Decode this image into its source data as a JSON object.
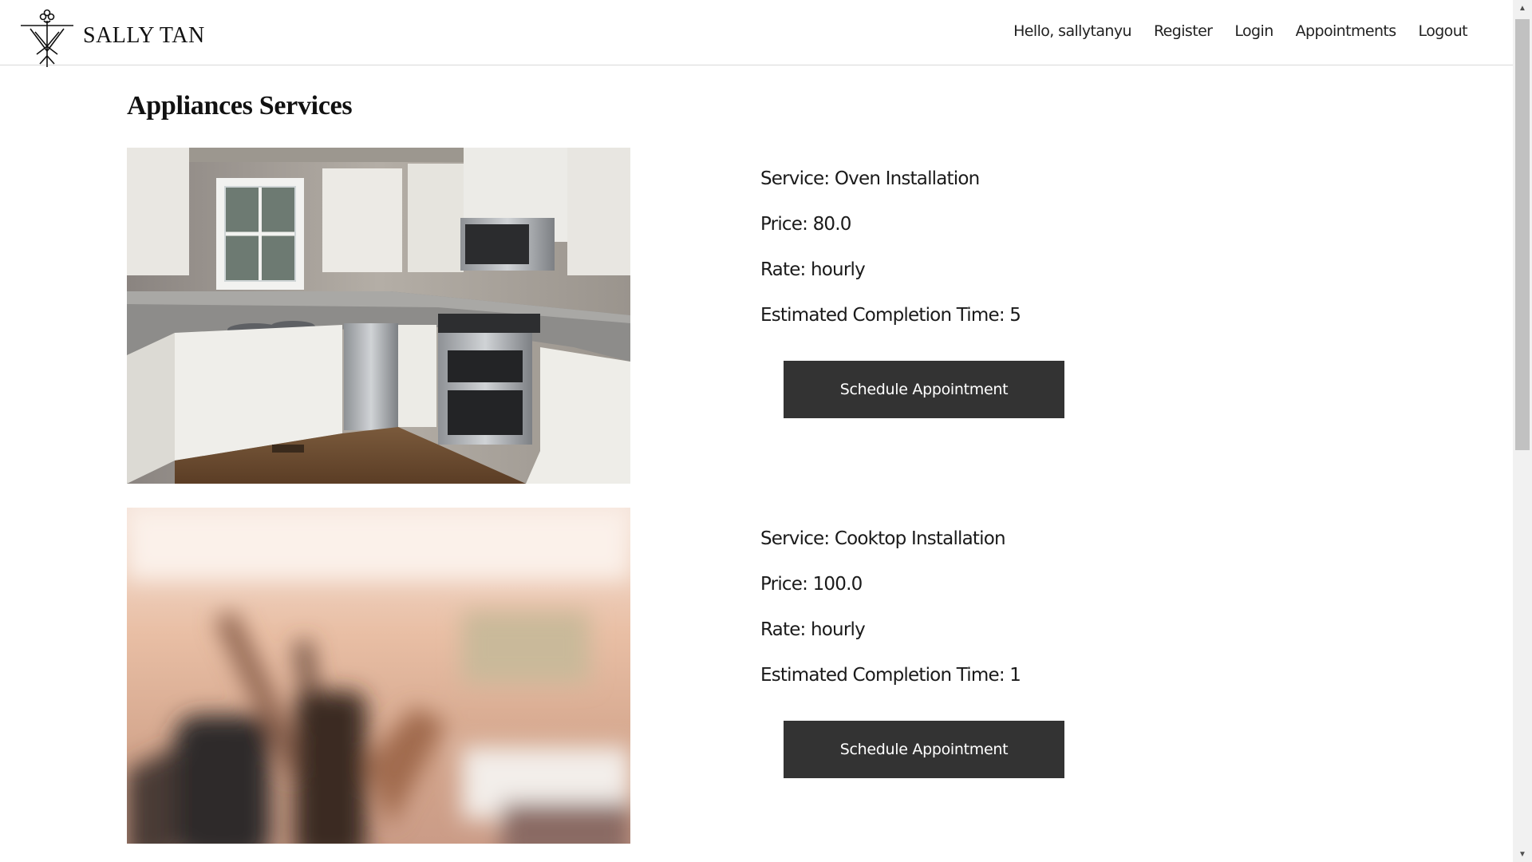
{
  "header": {
    "brand_name": "SALLY TAN",
    "nav": {
      "greeting": "Hello, sallytanyu",
      "register": "Register",
      "login": "Login",
      "appointments": "Appointments",
      "logout": "Logout"
    }
  },
  "main": {
    "title": "Appliances Services",
    "services": [
      {
        "service": "Service: Oven Installation",
        "price": "Price: 80.0",
        "rate": "Rate: hourly",
        "completion": "Estimated Completion Time: 5",
        "button_label": "Schedule Appointment",
        "image": "kitchen-photo"
      },
      {
        "service": "Service: Cooktop Installation",
        "price": "Price: 100.0",
        "rate": "Rate: hourly",
        "completion": "Estimated Completion Time: 1",
        "button_label": "Schedule Appointment",
        "image": "blurred-utensils-photo"
      }
    ]
  },
  "colors": {
    "button_bg": "#333333",
    "button_text": "#ffffff",
    "header_border": "#d9d9d9"
  },
  "icons": {
    "logo": "sally-tan-logo",
    "scroll_up": "scroll-up-arrow-icon",
    "scroll_down": "scroll-down-arrow-icon"
  }
}
